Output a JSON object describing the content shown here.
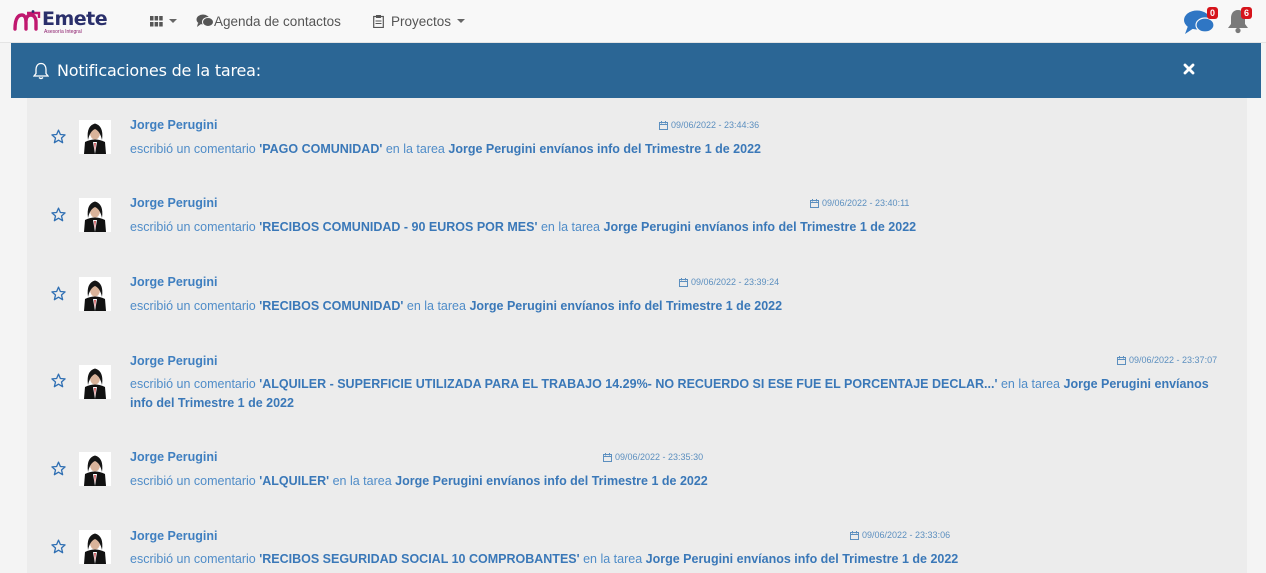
{
  "brand": {
    "name": "Emete",
    "subtitle": "Asesoría Integral"
  },
  "nav": {
    "contacts_label": "Agenda de contactos",
    "projects_label": "Proyectos"
  },
  "badges": {
    "messages": "0",
    "notifications": "6"
  },
  "panel": {
    "title": "Notificaciones de la tarea:"
  },
  "colors": {
    "header": "#2b6695",
    "link": "#3f7fc0",
    "badge": "#d6141b"
  },
  "notifications": [
    {
      "author": "Jorge Perugini",
      "date": "09/06/2022 - 23:44:36",
      "verb": "escribió un comentario",
      "comment": "'PAGO COMUNIDAD'",
      "connector": "en la tarea",
      "task": "Jorge Perugini envíanos info del Trimestre 1 de 2022"
    },
    {
      "author": "Jorge Perugini",
      "date": "09/06/2022 - 23:40:11",
      "verb": "escribió un comentario",
      "comment": "'RECIBOS COMUNIDAD - 90 EUROS POR MES'",
      "connector": "en la tarea",
      "task": "Jorge Perugini envíanos info del Trimestre 1 de 2022"
    },
    {
      "author": "Jorge Perugini",
      "date": "09/06/2022 - 23:39:24",
      "verb": "escribió un comentario",
      "comment": "'RECIBOS COMUNIDAD'",
      "connector": "en la tarea",
      "task": "Jorge Perugini envíanos info del Trimestre 1 de 2022"
    },
    {
      "author": "Jorge Perugini",
      "date": "09/06/2022 - 23:37:07",
      "verb": "escribió un comentario",
      "comment": "'ALQUILER - SUPERFICIE UTILIZADA PARA EL TRABAJO 14.29%- NO RECUERDO SI ESE FUE EL PORCENTAJE DECLAR...'",
      "connector": "en la tarea",
      "task": "Jorge Perugini envíanos info del Trimestre 1 de 2022"
    },
    {
      "author": "Jorge Perugini",
      "date": "09/06/2022 - 23:35:30",
      "verb": "escribió un comentario",
      "comment": "'ALQUILER'",
      "connector": "en la tarea",
      "task": "Jorge Perugini envíanos info del Trimestre 1 de 2022"
    },
    {
      "author": "Jorge Perugini",
      "date": "09/06/2022 - 23:33:06",
      "verb": "escribió un comentario",
      "comment": "'RECIBOS SEGURIDAD SOCIAL 10 COMPROBANTES'",
      "connector": "en la tarea",
      "task": "Jorge Perugini envíanos info del Trimestre 1 de 2022"
    }
  ]
}
